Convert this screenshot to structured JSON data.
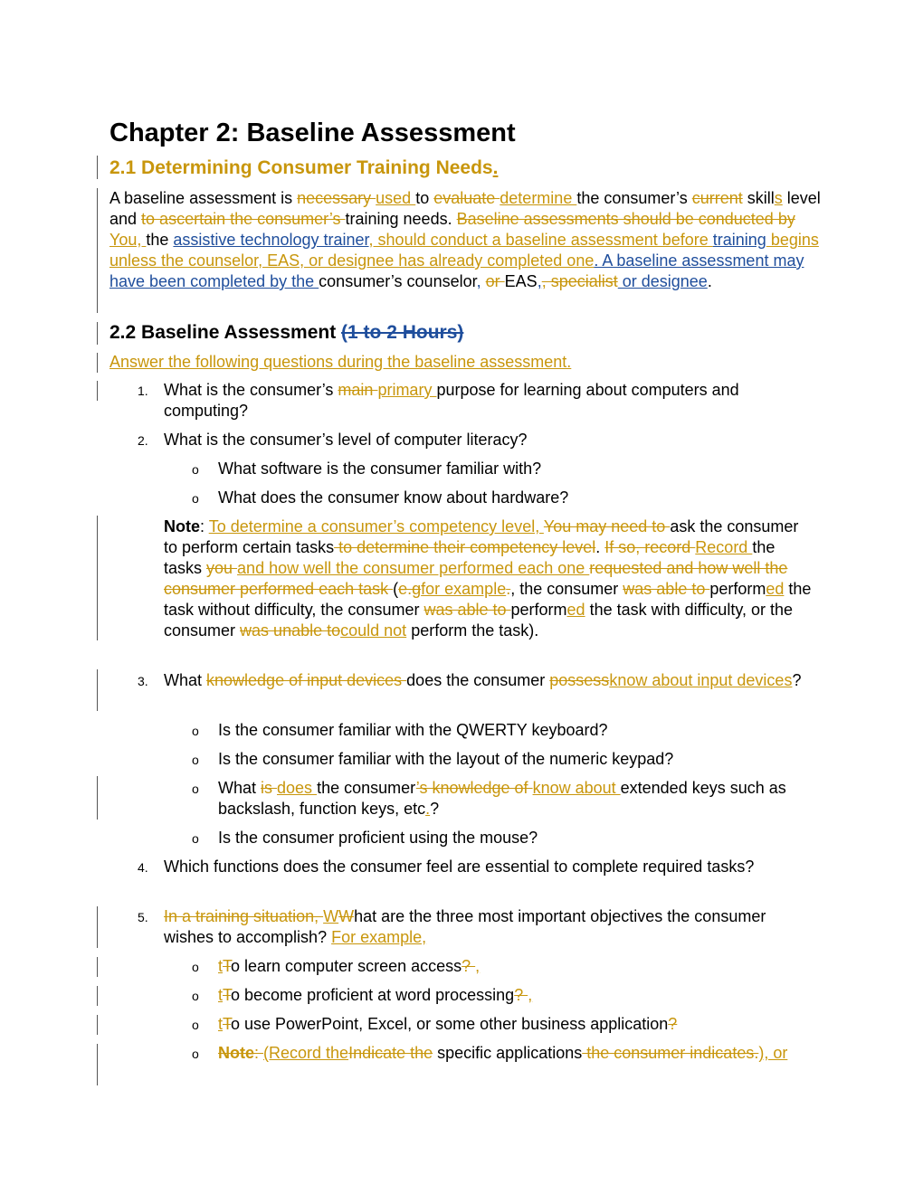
{
  "document": {
    "title": "Chapter 2: Baseline Assessment",
    "section_2_1": {
      "heading": "2.1 Determining Consumer Training Needs",
      "heading_inserted_period": ".",
      "para": [
        {
          "t": "A baseline assessment is ",
          "k": "n"
        },
        {
          "t": "necessary ",
          "k": "del"
        },
        {
          "t": "used ",
          "k": "ins"
        },
        {
          "t": "to ",
          "k": "n"
        },
        {
          "t": "evaluate ",
          "k": "del"
        },
        {
          "t": "determine ",
          "k": "ins"
        },
        {
          "t": "the consumer’s ",
          "k": "n"
        },
        {
          "t": "current",
          "k": "del"
        },
        {
          "t": " skill",
          "k": "n"
        },
        {
          "t": "s",
          "k": "ins"
        },
        {
          "t": " level and ",
          "k": "n"
        },
        {
          "t": "to ascertain the consumer’s ",
          "k": "del"
        },
        {
          "t": "training needs. ",
          "k": "n"
        },
        {
          "t": "Baseline assessments should be conducted by ",
          "k": "del"
        },
        {
          "t": "You, ",
          "k": "ins"
        },
        {
          "t": "the ",
          "k": "n"
        },
        {
          "t": "assistive technology trainer",
          "k": "insb"
        },
        {
          "t": ", should conduct a baseline assessment before ",
          "k": "ins"
        },
        {
          "t": "training",
          "k": "insb"
        },
        {
          "t": " begins unless the counselor, EAS, or designee has already completed one",
          "k": "ins"
        },
        {
          "t": ". A baseline assessment may have been completed by the ",
          "k": "insb"
        },
        {
          "t": "consumer’s counselor",
          "k": "n"
        },
        {
          "t": ",",
          "k": "insb"
        },
        {
          "t": " ",
          "k": "n"
        },
        {
          "t": "or ",
          "k": "del"
        },
        {
          "t": "EAS",
          "k": "n"
        },
        {
          "t": ",",
          "k": "insb"
        },
        {
          "t": ", specialist",
          "k": "del"
        },
        {
          "t": " or designee",
          "k": "insb"
        },
        {
          "t": ".",
          "k": "n"
        }
      ]
    },
    "section_2_2": {
      "heading": "2.2 Baseline Assessment ",
      "heading_deleted": "(1 to 2 Hours)",
      "intro": "Answer the following questions during the baseline assessment.",
      "items": [
        {
          "number": "1.",
          "runs": [
            {
              "t": "What is the consumer’s ",
              "k": "n"
            },
            {
              "t": "main ",
              "k": "del"
            },
            {
              "t": "primary ",
              "k": "ins"
            },
            {
              "t": "purpose for learning about computers and computing?",
              "k": "n"
            }
          ]
        },
        {
          "number": "2.",
          "runs": [
            {
              "t": "What is the consumer’s level of computer literacy?",
              "k": "n"
            }
          ],
          "subitems": [
            [
              {
                "t": "What software is the consumer familiar with?",
                "k": "n"
              }
            ],
            [
              {
                "t": "What does the consumer know about hardware?",
                "k": "n"
              }
            ]
          ],
          "note": [
            {
              "t": "Note",
              "k": "bold"
            },
            {
              "t": ": ",
              "k": "n"
            },
            {
              "t": "To determine a consumer’s competency level, ",
              "k": "ins"
            },
            {
              "t": "You may need to ",
              "k": "del"
            },
            {
              "t": "ask the consumer to perform certain tasks",
              "k": "n"
            },
            {
              "t": " to determine their competency level",
              "k": "del"
            },
            {
              "t": ". ",
              "k": "n"
            },
            {
              "t": "If so, record ",
              "k": "del"
            },
            {
              "t": "Record ",
              "k": "ins"
            },
            {
              "t": "the tasks ",
              "k": "n"
            },
            {
              "t": "you ",
              "k": "del"
            },
            {
              "t": "and how well the consumer performed each one ",
              "k": "ins"
            },
            {
              "t": "requested and how well the consumer performed each task ",
              "k": "del"
            },
            {
              "t": "(",
              "k": "n"
            },
            {
              "t": "e.g",
              "k": "del"
            },
            {
              "t": "for example",
              "k": "ins"
            },
            {
              "t": ".",
              "k": "del"
            },
            {
              "t": ", the consumer ",
              "k": "n"
            },
            {
              "t": "was able to ",
              "k": "del"
            },
            {
              "t": "perform",
              "k": "n"
            },
            {
              "t": "ed",
              "k": "ins"
            },
            {
              "t": " the task without difficulty, the consumer ",
              "k": "n"
            },
            {
              "t": "was able to ",
              "k": "del"
            },
            {
              "t": "perform",
              "k": "n"
            },
            {
              "t": "ed",
              "k": "ins"
            },
            {
              "t": " the task with difficulty, or the consumer ",
              "k": "n"
            },
            {
              "t": "was unable to",
              "k": "del"
            },
            {
              "t": "could not",
              "k": "ins"
            },
            {
              "t": " perform the task).",
              "k": "n"
            }
          ]
        },
        {
          "number": "3.",
          "runs": [
            {
              "t": "What ",
              "k": "n"
            },
            {
              "t": "knowledge of input devices ",
              "k": "del"
            },
            {
              "t": "does the consumer ",
              "k": "n"
            },
            {
              "t": "possess",
              "k": "del"
            },
            {
              "t": "know about input devices",
              "k": "ins"
            },
            {
              "t": "?",
              "k": "n"
            }
          ],
          "subitems": [
            [
              {
                "t": "Is the consumer familiar with the QWERTY keyboard?",
                "k": "n"
              }
            ],
            [
              {
                "t": "Is the consumer familiar with the layout of the numeric keypad?",
                "k": "n"
              }
            ],
            [
              {
                "t": "What ",
                "k": "n"
              },
              {
                "t": "is ",
                "k": "del"
              },
              {
                "t": "does ",
                "k": "ins"
              },
              {
                "t": "the consumer",
                "k": "n"
              },
              {
                "t": "’s knowledge of ",
                "k": "del"
              },
              {
                "t": " know about ",
                "k": "ins"
              },
              {
                "t": "extended keys such as backslash, function keys, etc",
                "k": "n"
              },
              {
                "t": ".",
                "k": "ins"
              },
              {
                "t": "?",
                "k": "n"
              }
            ],
            [
              {
                "t": "Is the consumer proficient using the mouse?",
                "k": "n"
              }
            ]
          ]
        },
        {
          "number": "4.",
          "runs": [
            {
              "t": "Which functions does the consumer feel are essential to complete required tasks?",
              "k": "n"
            }
          ]
        },
        {
          "number": "5.",
          "runs": [
            {
              "t": "In a training situation, ",
              "k": "del"
            },
            {
              "t": "W",
              "k": "ins"
            },
            {
              "t": "W",
              "k": "del"
            },
            {
              "t": "hat are the three most important objectives the consumer wishes to accomplish? ",
              "k": "n"
            },
            {
              "t": "For example,",
              "k": "ins"
            }
          ],
          "subitems": [
            [
              {
                "t": "t",
                "k": "ins"
              },
              {
                "t": "T",
                "k": "del"
              },
              {
                "t": "o learn computer screen access",
                "k": "n"
              },
              {
                "t": "? ",
                "k": "del"
              },
              {
                "t": ",",
                "k": "ins"
              }
            ],
            [
              {
                "t": "t",
                "k": "ins"
              },
              {
                "t": "T",
                "k": "del"
              },
              {
                "t": "o become proficient at word processing",
                "k": "n"
              },
              {
                "t": "? ",
                "k": "del"
              },
              {
                "t": ",",
                "k": "ins"
              }
            ],
            [
              {
                "t": "t",
                "k": "ins"
              },
              {
                "t": "T",
                "k": "del"
              },
              {
                "t": "o use PowerPoint, Excel, or some other business application",
                "k": "n"
              },
              {
                "t": "? ",
                "k": "del"
              }
            ],
            [
              {
                "t": "Note",
                "k": "delbold"
              },
              {
                "t": ": ",
                "k": "del"
              },
              {
                "t": " (Record the",
                "k": "ins"
              },
              {
                "t": "Indicate the",
                "k": "del"
              },
              {
                "t": " specific applications",
                "k": "n"
              },
              {
                "t": " the consumer indicates.",
                "k": "del"
              },
              {
                "t": "), or",
                "k": "ins"
              }
            ]
          ]
        }
      ]
    },
    "colors": {
      "revision_gold": "#c8960c",
      "revision_blue": "#1f4e9c",
      "change_bar": "#555555"
    }
  }
}
